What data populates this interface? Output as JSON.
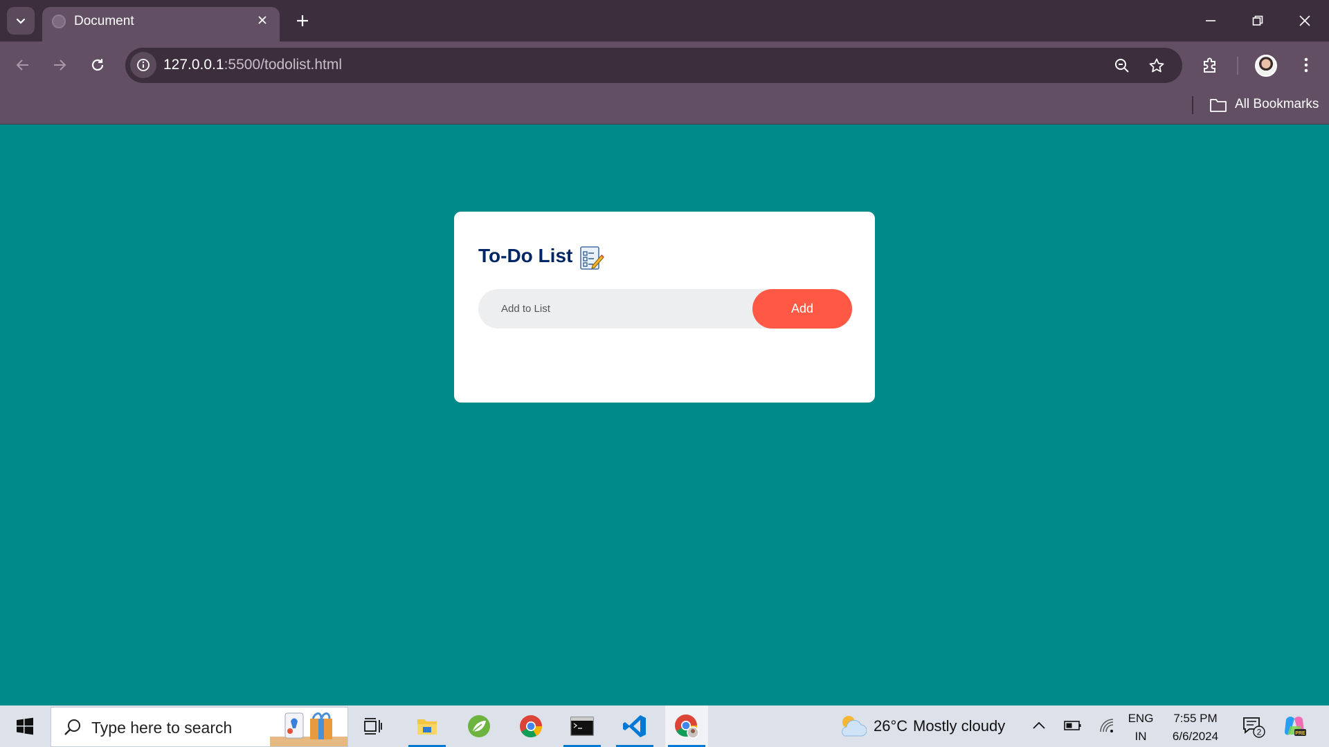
{
  "browser": {
    "tab_title": "Document",
    "url_host": "127.0.0.1",
    "url_rest": ":5500/todolist.html",
    "bookmarks_label": "All Bookmarks"
  },
  "app": {
    "title": "To-Do List",
    "input_placeholder": "Add to List",
    "input_value": "",
    "add_label": "Add"
  },
  "taskbar": {
    "search_placeholder": "Type here to search",
    "weather_temp": "26°C",
    "weather_desc": "Mostly cloudy",
    "lang_line1": "ENG",
    "lang_line2": "IN",
    "time": "7:55 PM",
    "date": "6/6/2024",
    "notification_count": "2",
    "apps": [
      "task-view",
      "file-explorer",
      "spring-tool-suite",
      "chrome",
      "terminal",
      "vscode",
      "chrome-profile"
    ]
  },
  "colors": {
    "page_background": "#008b8b",
    "add_button": "#ff5945",
    "title_text": "#002765",
    "browser_frame": "#624f63"
  }
}
